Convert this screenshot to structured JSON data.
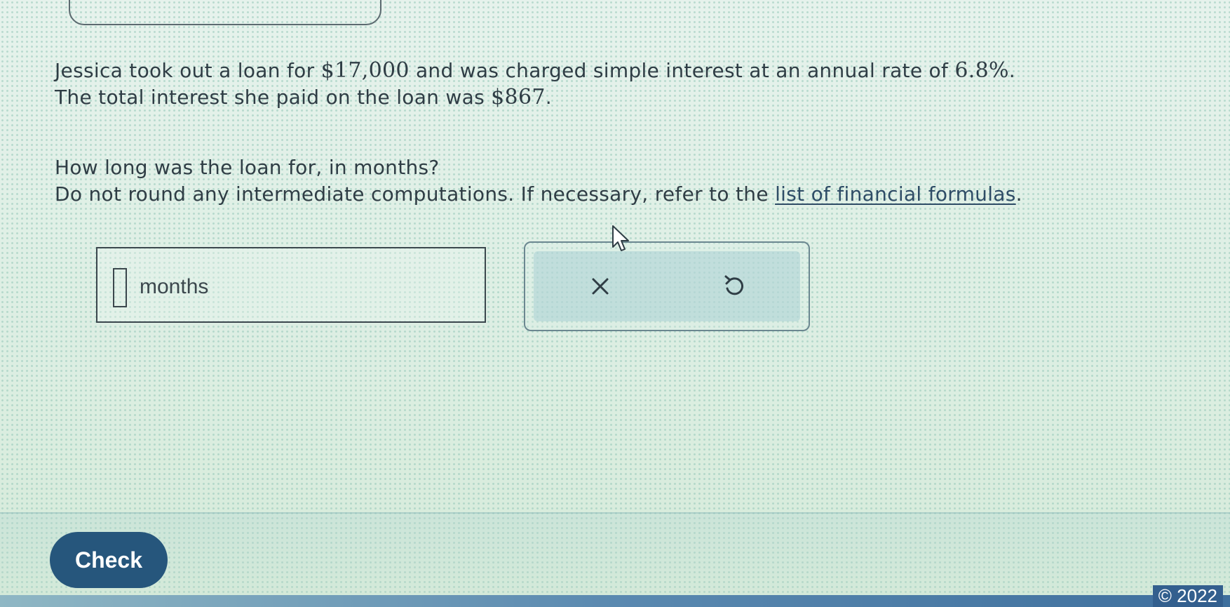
{
  "question": {
    "line1_before_amount": "Jessica took out a loan for ",
    "loan_amount": "$17,000",
    "line1_middle": " and was charged simple interest at an annual rate of ",
    "interest_rate": "6.8%",
    "line1_end": ".",
    "line2_before_amount": "The total interest she paid on the loan was ",
    "interest_amount": "$867",
    "line2_end": ".",
    "prompt": "How long was the loan for, in months?",
    "instruction_before_link": "Do not round any intermediate computations. If necessary, refer to the ",
    "formula_link": "list of financial formulas",
    "instruction_end": "."
  },
  "answer": {
    "value": "",
    "unit": "months"
  },
  "actions": {
    "clear_icon": "x-icon",
    "undo_icon": "undo-icon"
  },
  "check_button": {
    "label": "Check",
    "color": "#26567c"
  },
  "footer": {
    "copyright": "© 2022"
  }
}
